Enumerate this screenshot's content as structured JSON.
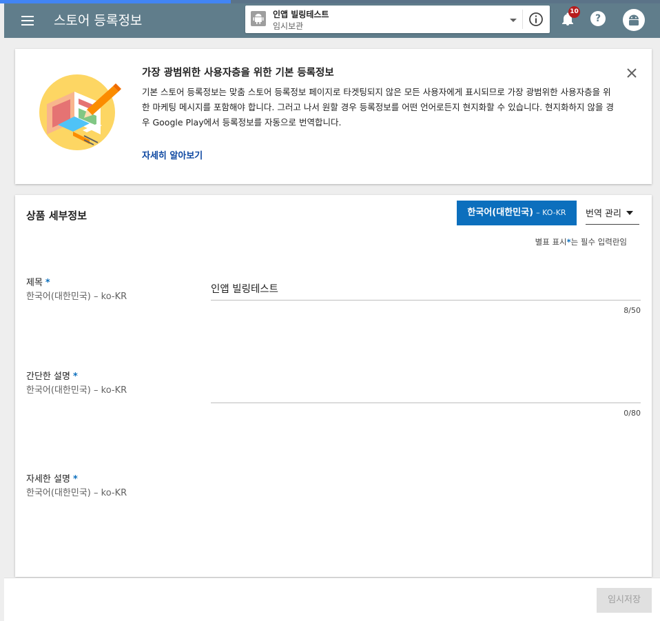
{
  "progress": {
    "value_percent": 35,
    "color": "#4285f4"
  },
  "header": {
    "title": "스토어 등록정보",
    "app_selector": {
      "app_name": "인앱 빌링테스트",
      "status": "임시보관"
    },
    "notifications_count": "10",
    "help_symbol": "?",
    "bar_color": "#607d8b"
  },
  "banner": {
    "title": "가장 광범위한 사용자층을 위한 기본 등록정보",
    "body": "기본 스토어 등록정보는 맞춤 스토어 등록정보 페이지로 타겟팅되지 않은 모든 사용자에게 표시되므로 가장 광범위한 사용자층을 위한 마케팅 메시지를 포함해야 합니다. 그러고 나서 원할 경우 등록정보를 어떤 언어로든지 현지화할 수 있습니다. 현지화하지 않을 경우 Google Play에서 등록정보를 자동으로 번역합니다.",
    "learn_more": "자세히 알아보기",
    "link_color": "#0d47a1"
  },
  "details": {
    "title": "상품 세부정보",
    "language_button": {
      "label": "한국어(대한민국)",
      "code": "– KO-KR",
      "color": "#0c6fbd"
    },
    "translation_menu": "번역 관리",
    "required_note_prefix": "별표 표시",
    "required_star": "*",
    "required_note_suffix": "는 필수 입력란임",
    "fields": [
      {
        "label": "제목",
        "star": "*",
        "lang": "한국어(대한민국) – ko-KR",
        "value": "인앱 빌링테스트",
        "counter": "8/50"
      },
      {
        "label": "간단한 설명",
        "star": "*",
        "lang": "한국어(대한민국) – ko-KR",
        "value": "",
        "counter": "0/80"
      },
      {
        "label": "자세한 설명",
        "star": "*",
        "lang": "한국어(대한민국) – ko-KR"
      }
    ]
  },
  "footer": {
    "save_label": "임시저장"
  },
  "icons": [
    "menu-icon",
    "android-icon",
    "chevron-down-icon",
    "info-icon",
    "bell-icon",
    "help-icon",
    "avatar-icon",
    "close-icon",
    "store-illustration"
  ]
}
